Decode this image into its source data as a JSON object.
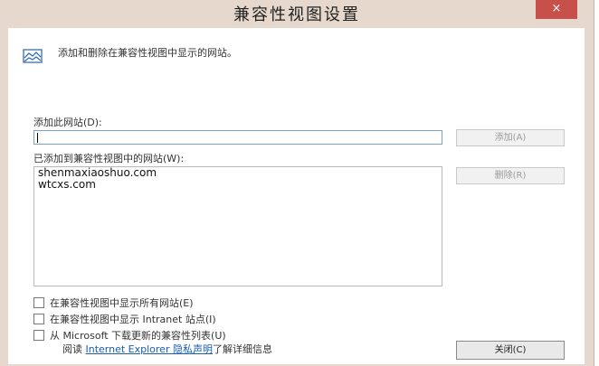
{
  "window": {
    "title": "兼容性视图设置",
    "close_glyph": "×"
  },
  "intro": {
    "text": "添加和删除在兼容性视图中显示的网站。",
    "icon": "compatibility-view-icon"
  },
  "add_site": {
    "label": "添加此网站(D):",
    "value": "",
    "add_button": "添加(A)"
  },
  "sites": {
    "label": "已添加到兼容性视图中的网站(W):",
    "items": [
      "shenmaxiaoshuo.com",
      "wtcxs.com"
    ],
    "remove_button": "删除(R)"
  },
  "options": [
    {
      "label": "在兼容性视图中显示所有网站(E)",
      "checked": false
    },
    {
      "label": "在兼容性视图中显示 Intranet 站点(I)",
      "checked": false
    },
    {
      "label": "从 Microsoft 下载更新的兼容性列表(U)",
      "checked": false
    }
  ],
  "privacy": {
    "prefix": "阅读",
    "link_text": "Internet Explorer 隐私声明",
    "suffix": "了解详细信息"
  },
  "close_button": "关闭(C)",
  "colors": {
    "frame": "#e6d8cd",
    "close_button": "#c7504a",
    "link": "#1a5bb0"
  }
}
